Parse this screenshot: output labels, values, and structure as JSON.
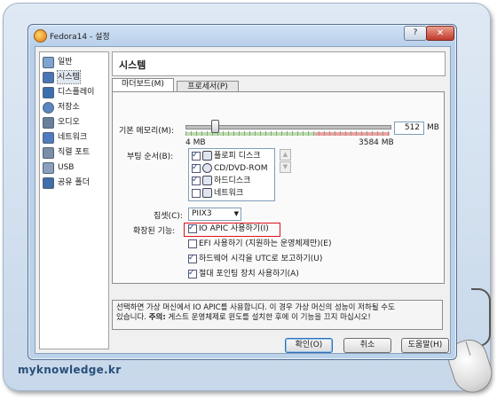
{
  "site_watermark": "myknowledge.kr",
  "window": {
    "title": "Fedora14 - 설정",
    "help_button": "?",
    "close_button": "✕"
  },
  "sidebar": {
    "items": [
      {
        "label": "일반",
        "icon": "general-icon"
      },
      {
        "label": "시스템",
        "icon": "system-icon",
        "selected": true
      },
      {
        "label": "디스플레이",
        "icon": "display-icon"
      },
      {
        "label": "저장소",
        "icon": "storage-icon"
      },
      {
        "label": "오디오",
        "icon": "audio-icon"
      },
      {
        "label": "네트워크",
        "icon": "network-icon"
      },
      {
        "label": "직렬 포트",
        "icon": "serial-port-icon"
      },
      {
        "label": "USB",
        "icon": "usb-icon"
      },
      {
        "label": "공유 폴더",
        "icon": "shared-folder-icon"
      }
    ]
  },
  "page_title": "시스템",
  "tabs": [
    {
      "label": "마더보드(M)",
      "selected": true
    },
    {
      "label": "프로세서(P)",
      "selected": false
    }
  ],
  "motherboard": {
    "memory_label": "기본 메모리(M):",
    "memory_value": "512",
    "memory_unit": "MB",
    "memory_min": "4 MB",
    "memory_max": "3584 MB",
    "memory_fraction": 0.143,
    "boot_order_label": "부팅 순서(B):",
    "boot_items": [
      {
        "label": "플로피 디스크",
        "checked": true,
        "icon": "floppy-icon"
      },
      {
        "label": "CD/DVD-ROM",
        "checked": true,
        "icon": "cd-icon"
      },
      {
        "label": "하드디스크",
        "checked": true,
        "icon": "harddisk-icon"
      },
      {
        "label": "네트워크",
        "checked": false,
        "icon": "network-icon"
      }
    ],
    "chipset_label": "칩셋(C):",
    "chipset_value": "PIIX3",
    "extended_label": "확장된 기능:",
    "features": [
      {
        "label": "IO APIC 사용하기(I)",
        "checked": true
      },
      {
        "label": "EFI 사용하기 (지원하는 운영체제만)(E)",
        "checked": false
      },
      {
        "label": "하드웨어 시각을 UTC로 보고하기(U)",
        "checked": true
      },
      {
        "label": "절대 포인팅 장치 사용하기(A)",
        "checked": true
      }
    ]
  },
  "info_text": {
    "line1": "선택하면 가상 머신에서 IO APIC를 사용합니다. 이 경우 가상 머신의 성능이 저하될 수도",
    "line2_prefix": "있습니다.",
    "line2_bold": "주의:",
    "line2_suffix": "게스트 운영체제로 윈도를 설치한 후에 이 기능을 끄지 마십시오!"
  },
  "buttons": {
    "ok": "확인(O)",
    "cancel": "취소",
    "help": "도움말(H)"
  }
}
